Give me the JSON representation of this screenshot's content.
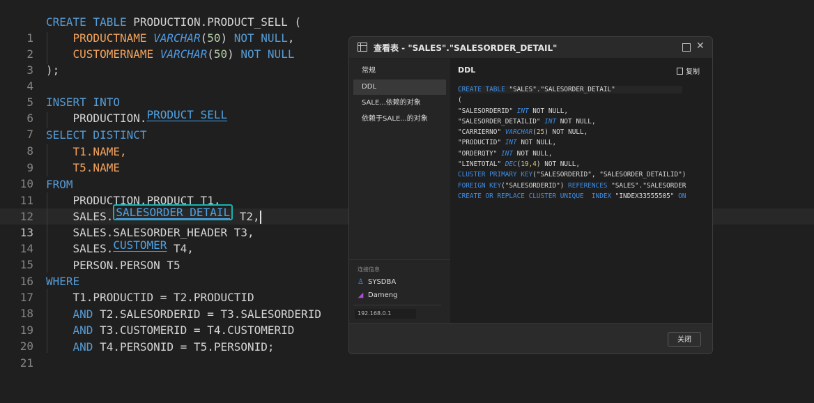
{
  "editor": {
    "line_numbers": [
      "1",
      "2",
      "3",
      "4",
      "5",
      "6",
      "7",
      "8",
      "9",
      "10",
      "11",
      "12",
      "13",
      "14",
      "15",
      "16",
      "17",
      "18",
      "19",
      "20",
      "21"
    ],
    "l1": {
      "kw1": "CREATE",
      "kw2": "TABLE",
      "ident": "PRODUCTION.PRODUCT_SELL (",
      "tail": ""
    },
    "l2": {
      "col": "PRODUCTNAME",
      "type": "VARCHAR",
      "p1": "(",
      "num": "50",
      "p2": ")",
      "kw": "NOT NULL",
      "comma": ","
    },
    "l3": {
      "col": "CUSTOMERNAME",
      "type": "VARCHAR",
      "p1": "(",
      "num": "50",
      "p2": ")",
      "kw": "NOT NULL"
    },
    "l4": ");",
    "l6": {
      "kw": "INSERT INTO"
    },
    "l7": {
      "prefix": "PRODUCTION.",
      "link": "PRODUCT_SELL"
    },
    "l8": {
      "kw": "SELECT DISTINCT"
    },
    "l9": {
      "text": "T1.NAME,"
    },
    "l10": {
      "text": "T5.NAME"
    },
    "l11": {
      "kw": "FROM"
    },
    "l12": {
      "text": "PRODUCTION.PRODUCT T1,"
    },
    "l13": {
      "prefix": "SALES.",
      "link": "SALESORDER_DETAIL",
      "suffix": " T2,"
    },
    "l14": {
      "text": "SALES.SALESORDER_HEADER T3,"
    },
    "l15": {
      "prefix": "SALES.",
      "link": "CUSTOMER",
      "suffix": " T4,"
    },
    "l16": {
      "text": "PERSON.PERSON T5"
    },
    "l17": {
      "kw": "WHERE"
    },
    "l18": {
      "text": "T1.PRODUCTID = T2.PRODUCTID"
    },
    "l19": {
      "kw": "AND",
      "text": " T2.SALESORDERID = T3.SALESORDERID"
    },
    "l20": {
      "kw": "AND",
      "text": " T3.CUSTOMERID = T4.CUSTOMERID"
    },
    "l21": {
      "kw": "AND",
      "text": " T4.PERSONID = T5.PERSONID;"
    }
  },
  "dialog": {
    "title": "查看表 - \"SALES\".\"SALESORDER_DETAIL\"",
    "side_items": [
      "常规",
      "DDL",
      "SALE...依赖的对象",
      "依赖于SALE...的对象"
    ],
    "conn_label": "连接信息",
    "conn_user": "SYSDBA",
    "conn_db": "Dameng",
    "ip": "192.168.0.1",
    "ddl_title": "DDL",
    "copy_label": "复制",
    "close_label": "关闭",
    "ddl": {
      "l1a": "CREATE TABLE",
      "l1b": " \"SALES\".\"SALESORDER_DETAIL\"",
      "l2": "(",
      "l3a": "\"SALESORDERID\" ",
      "l3t": "INT",
      "l3k": " NOT NULL",
      "l3e": ",",
      "l4a": "\"SALESORDER_DETAILID\" ",
      "l4t": "INT",
      "l4k": " NOT NULL",
      "l4e": ",",
      "l5a": "\"CARRIERNO\" ",
      "l5t": "VARCHAR",
      "l5p": "(",
      "l5n": "25",
      "l5q": ")",
      "l5k": " NOT NULL",
      "l5e": ",",
      "l6a": "\"PRODUCTID\" ",
      "l6t": "INT",
      "l6k": " NOT NULL",
      "l6e": ",",
      "l7a": "\"ORDERQTY\" ",
      "l7t": "INT",
      "l7k": " NOT NULL",
      "l7e": ",",
      "l8a": "\"LINETOTAL\" ",
      "l8t": "DEC",
      "l8p": "(",
      "l8n": "19,4",
      "l8q": ")",
      "l8k": " NOT NULL",
      "l8e": ",",
      "l9a": "CLUSTER PRIMARY KEY",
      "l9b": "(\"SALESORDERID\", \"SALESORDER_DETAILID\")",
      "l10a": "FOREIGN KEY",
      "l10b": "(\"SALESORDERID\") ",
      "l10c": "REFERENCES",
      "l10d": " \"SALES\".\"SALESORDER",
      "l11a": "CREATE OR REPLACE CLUSTER UNIQUE  INDEX",
      "l11b": " \"INDEX33555505\" ",
      "l11c": "ON"
    }
  }
}
